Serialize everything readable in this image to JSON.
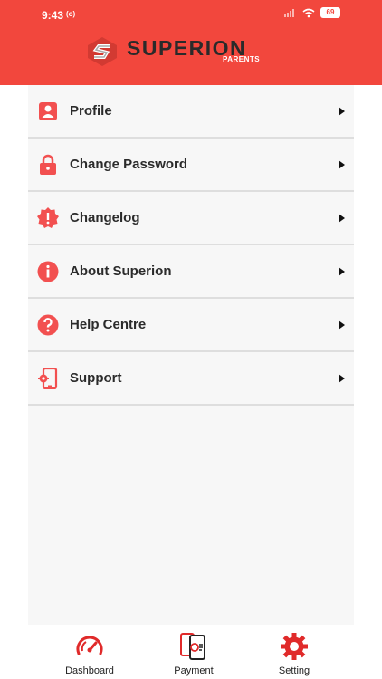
{
  "status_bar": {
    "time": "9:43",
    "recording": "(o)",
    "battery": "69"
  },
  "header": {
    "logo_text": "SUPERION",
    "logo_sub": "PARENTS"
  },
  "menu": [
    {
      "label": "Profile",
      "icon": "person-icon"
    },
    {
      "label": "Change Password",
      "icon": "lock-icon"
    },
    {
      "label": "Changelog",
      "icon": "alert-badge-icon"
    },
    {
      "label": "About Superion",
      "icon": "info-icon"
    },
    {
      "label": "Help Centre",
      "icon": "question-icon"
    },
    {
      "label": "Support",
      "icon": "phone-gear-icon"
    }
  ],
  "bottom_nav": [
    {
      "label": "Dashboard",
      "icon": "speedometer-icon"
    },
    {
      "label": "Payment",
      "icon": "payment-phone-icon"
    },
    {
      "label": "Setting",
      "icon": "gear-icon"
    }
  ],
  "colors": {
    "accent": "#f2473d",
    "icon": "#f25050",
    "background": "#f7f7f7"
  }
}
